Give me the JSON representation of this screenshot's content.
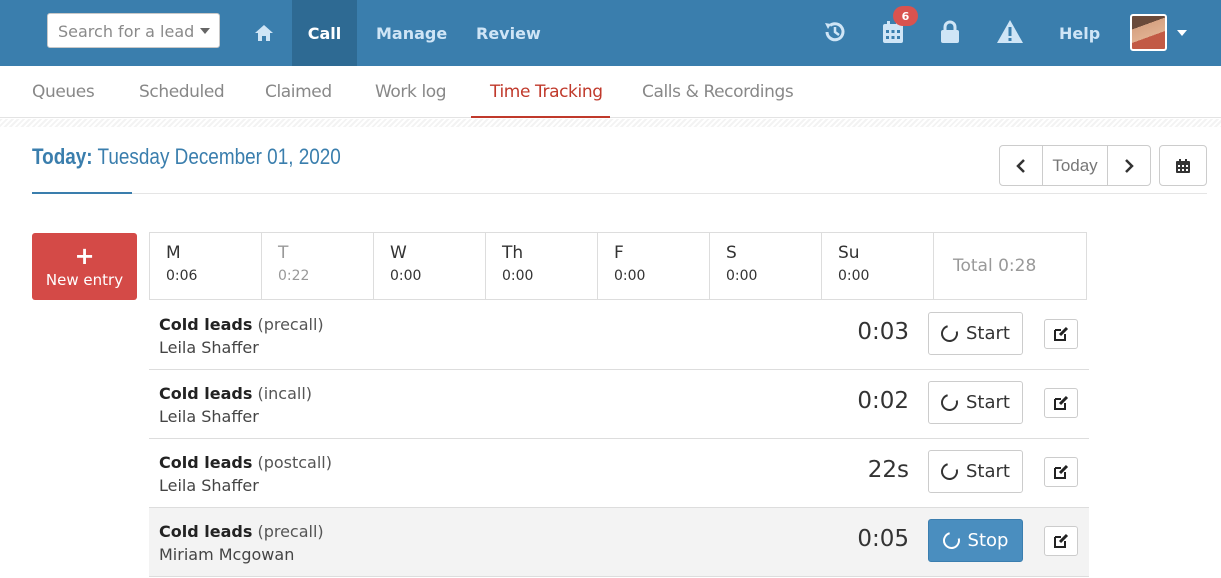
{
  "topbar": {
    "search_placeholder": "Search for a lead",
    "nav": {
      "call": "Call",
      "manage": "Manage",
      "review": "Review",
      "help": "Help"
    },
    "calendar_badge": "6"
  },
  "subtabs": [
    "Queues",
    "Scheduled",
    "Claimed",
    "Work log",
    "Time Tracking",
    "Calls & Recordings"
  ],
  "active_subtab": "Time Tracking",
  "header": {
    "today_label": "Today:",
    "date": "Tuesday December 01, 2020",
    "today_button": "Today"
  },
  "new_entry": {
    "plus": "+",
    "label": "New entry"
  },
  "week": {
    "days": [
      {
        "day": "M",
        "time": "0:06"
      },
      {
        "day": "T",
        "time": "0:22"
      },
      {
        "day": "W",
        "time": "0:00"
      },
      {
        "day": "Th",
        "time": "0:00"
      },
      {
        "day": "F",
        "time": "0:00"
      },
      {
        "day": "S",
        "time": "0:00"
      },
      {
        "day": "Su",
        "time": "0:00"
      }
    ],
    "total": "Total 0:28"
  },
  "entries": [
    {
      "queue": "Cold leads",
      "phase": "(precall)",
      "person": "Leila Shaffer",
      "duration": "0:03",
      "button": "Start"
    },
    {
      "queue": "Cold leads",
      "phase": "(incall)",
      "person": "Leila Shaffer",
      "duration": "0:02",
      "button": "Start"
    },
    {
      "queue": "Cold leads",
      "phase": "(postcall)",
      "person": "Leila Shaffer",
      "duration": "22s",
      "button": "Start"
    },
    {
      "queue": "Cold leads",
      "phase": "(precall)",
      "person": "Miriam Mcgowan",
      "duration": "0:05",
      "button": "Stop"
    }
  ],
  "colors": {
    "brand": "#3a7ead",
    "accent_red": "#d44a47",
    "stop_blue": "#4a8ebf"
  }
}
